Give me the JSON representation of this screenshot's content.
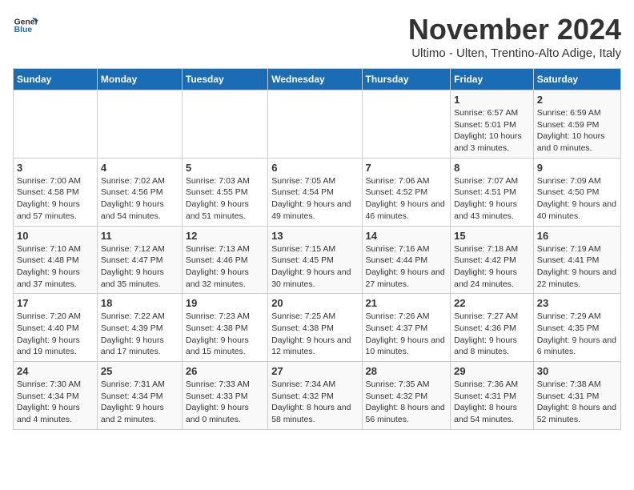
{
  "logo": {
    "general": "General",
    "blue": "Blue"
  },
  "header": {
    "month": "November 2024",
    "location": "Ultimo - Ulten, Trentino-Alto Adige, Italy"
  },
  "weekdays": [
    "Sunday",
    "Monday",
    "Tuesday",
    "Wednesday",
    "Thursday",
    "Friday",
    "Saturday"
  ],
  "weeks": [
    [
      {
        "day": "",
        "info": ""
      },
      {
        "day": "",
        "info": ""
      },
      {
        "day": "",
        "info": ""
      },
      {
        "day": "",
        "info": ""
      },
      {
        "day": "",
        "info": ""
      },
      {
        "day": "1",
        "info": "Sunrise: 6:57 AM\nSunset: 5:01 PM\nDaylight: 10 hours and 3 minutes."
      },
      {
        "day": "2",
        "info": "Sunrise: 6:59 AM\nSunset: 4:59 PM\nDaylight: 10 hours and 0 minutes."
      }
    ],
    [
      {
        "day": "3",
        "info": "Sunrise: 7:00 AM\nSunset: 4:58 PM\nDaylight: 9 hours and 57 minutes."
      },
      {
        "day": "4",
        "info": "Sunrise: 7:02 AM\nSunset: 4:56 PM\nDaylight: 9 hours and 54 minutes."
      },
      {
        "day": "5",
        "info": "Sunrise: 7:03 AM\nSunset: 4:55 PM\nDaylight: 9 hours and 51 minutes."
      },
      {
        "day": "6",
        "info": "Sunrise: 7:05 AM\nSunset: 4:54 PM\nDaylight: 9 hours and 49 minutes."
      },
      {
        "day": "7",
        "info": "Sunrise: 7:06 AM\nSunset: 4:52 PM\nDaylight: 9 hours and 46 minutes."
      },
      {
        "day": "8",
        "info": "Sunrise: 7:07 AM\nSunset: 4:51 PM\nDaylight: 9 hours and 43 minutes."
      },
      {
        "day": "9",
        "info": "Sunrise: 7:09 AM\nSunset: 4:50 PM\nDaylight: 9 hours and 40 minutes."
      }
    ],
    [
      {
        "day": "10",
        "info": "Sunrise: 7:10 AM\nSunset: 4:48 PM\nDaylight: 9 hours and 37 minutes."
      },
      {
        "day": "11",
        "info": "Sunrise: 7:12 AM\nSunset: 4:47 PM\nDaylight: 9 hours and 35 minutes."
      },
      {
        "day": "12",
        "info": "Sunrise: 7:13 AM\nSunset: 4:46 PM\nDaylight: 9 hours and 32 minutes."
      },
      {
        "day": "13",
        "info": "Sunrise: 7:15 AM\nSunset: 4:45 PM\nDaylight: 9 hours and 30 minutes."
      },
      {
        "day": "14",
        "info": "Sunrise: 7:16 AM\nSunset: 4:44 PM\nDaylight: 9 hours and 27 minutes."
      },
      {
        "day": "15",
        "info": "Sunrise: 7:18 AM\nSunset: 4:42 PM\nDaylight: 9 hours and 24 minutes."
      },
      {
        "day": "16",
        "info": "Sunrise: 7:19 AM\nSunset: 4:41 PM\nDaylight: 9 hours and 22 minutes."
      }
    ],
    [
      {
        "day": "17",
        "info": "Sunrise: 7:20 AM\nSunset: 4:40 PM\nDaylight: 9 hours and 19 minutes."
      },
      {
        "day": "18",
        "info": "Sunrise: 7:22 AM\nSunset: 4:39 PM\nDaylight: 9 hours and 17 minutes."
      },
      {
        "day": "19",
        "info": "Sunrise: 7:23 AM\nSunset: 4:38 PM\nDaylight: 9 hours and 15 minutes."
      },
      {
        "day": "20",
        "info": "Sunrise: 7:25 AM\nSunset: 4:38 PM\nDaylight: 9 hours and 12 minutes."
      },
      {
        "day": "21",
        "info": "Sunrise: 7:26 AM\nSunset: 4:37 PM\nDaylight: 9 hours and 10 minutes."
      },
      {
        "day": "22",
        "info": "Sunrise: 7:27 AM\nSunset: 4:36 PM\nDaylight: 9 hours and 8 minutes."
      },
      {
        "day": "23",
        "info": "Sunrise: 7:29 AM\nSunset: 4:35 PM\nDaylight: 9 hours and 6 minutes."
      }
    ],
    [
      {
        "day": "24",
        "info": "Sunrise: 7:30 AM\nSunset: 4:34 PM\nDaylight: 9 hours and 4 minutes."
      },
      {
        "day": "25",
        "info": "Sunrise: 7:31 AM\nSunset: 4:34 PM\nDaylight: 9 hours and 2 minutes."
      },
      {
        "day": "26",
        "info": "Sunrise: 7:33 AM\nSunset: 4:33 PM\nDaylight: 9 hours and 0 minutes."
      },
      {
        "day": "27",
        "info": "Sunrise: 7:34 AM\nSunset: 4:32 PM\nDaylight: 8 hours and 58 minutes."
      },
      {
        "day": "28",
        "info": "Sunrise: 7:35 AM\nSunset: 4:32 PM\nDaylight: 8 hours and 56 minutes."
      },
      {
        "day": "29",
        "info": "Sunrise: 7:36 AM\nSunset: 4:31 PM\nDaylight: 8 hours and 54 minutes."
      },
      {
        "day": "30",
        "info": "Sunrise: 7:38 AM\nSunset: 4:31 PM\nDaylight: 8 hours and 52 minutes."
      }
    ]
  ]
}
